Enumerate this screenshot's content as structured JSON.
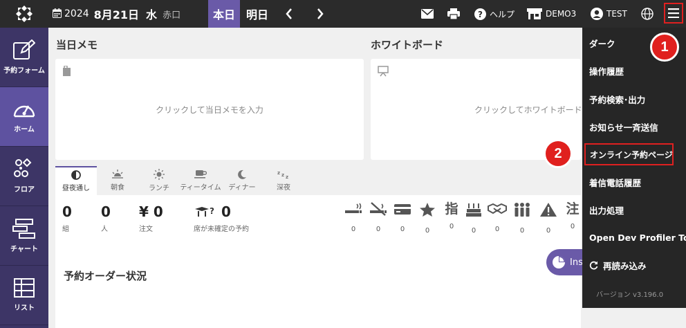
{
  "topbar": {
    "year": "2024",
    "date": "8月21日",
    "weekday": "水",
    "rokuyo": "赤口",
    "today_label": "本日",
    "tomorrow_label": "明日",
    "help_label": "ヘルプ",
    "store_label": "DEMO3",
    "user_label": "TEST"
  },
  "sidebar": {
    "items": [
      {
        "label": "予約フォーム"
      },
      {
        "label": "ホーム"
      },
      {
        "label": "フロア"
      },
      {
        "label": "チャート"
      },
      {
        "label": "リスト"
      }
    ]
  },
  "memo": {
    "title": "当日メモ",
    "hint": "クリックして当日メモを入力"
  },
  "whiteboard": {
    "title": "ホワイトボード",
    "hint": "クリックしてホワイトボードを入力"
  },
  "tabs": [
    {
      "label": "昼夜通し"
    },
    {
      "label": "朝食"
    },
    {
      "label": "ランチ"
    },
    {
      "label": "ティータイム"
    },
    {
      "label": "ディナー"
    },
    {
      "label": "深夜"
    }
  ],
  "stats": {
    "groups": {
      "value": "0",
      "label": "組"
    },
    "people": {
      "value": "0",
      "label": "人"
    },
    "orders": {
      "value": "¥ 0",
      "label": "注文"
    },
    "unassigned": {
      "value": "0",
      "label": "席が未確定の予約"
    }
  },
  "mini_stats": [
    {
      "icon": "smoking-icon",
      "count": "0"
    },
    {
      "icon": "no-smoking-icon",
      "count": "0"
    },
    {
      "icon": "credit-card-icon",
      "count": "0"
    },
    {
      "icon": "star-icon",
      "count": "0"
    },
    {
      "icon": "designated-icon",
      "count": "0",
      "glyph": "指"
    },
    {
      "icon": "cake-icon",
      "count": "0"
    },
    {
      "icon": "handshake-icon",
      "count": "0"
    },
    {
      "icon": "group-icon",
      "count": "0"
    },
    {
      "icon": "warning-icon",
      "count": "0"
    },
    {
      "icon": "note-icon",
      "count": "0",
      "glyph": "注"
    }
  ],
  "order_status": {
    "title": "予約オーダー状況",
    "insight_label": "Ins"
  },
  "menu": {
    "items": [
      {
        "label": "ダーク"
      },
      {
        "label": "操作履歴"
      },
      {
        "label": "予約検索･出力"
      },
      {
        "label": "お知らせ一斉送信"
      },
      {
        "label": "オンライン予約ページ"
      },
      {
        "label": "着信電話履歴"
      },
      {
        "label": "出力処理"
      },
      {
        "label": "Open Dev Profiler Tool"
      },
      {
        "label": "再読み込み"
      }
    ],
    "version": "バージョン v3.196.0"
  },
  "callouts": [
    "1",
    "2"
  ],
  "colors": {
    "topbar": "#2b2b2b",
    "sidebar": "#3d3566",
    "accent": "#6a5aa8",
    "dropdown": "#262626",
    "callout": "#e0201e"
  }
}
